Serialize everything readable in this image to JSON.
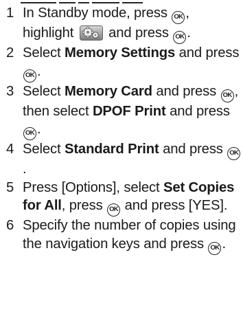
{
  "ok_glyph": "OK",
  "icons": {
    "settings": "settings-gear-icon"
  },
  "steps": [
    {
      "num": "1",
      "parts": [
        {
          "t": "text",
          "v": "In Standby mode, press "
        },
        {
          "t": "ok"
        },
        {
          "t": "text",
          "v": ", highlight "
        },
        {
          "t": "icon"
        },
        {
          "t": "text",
          "v": " and press "
        },
        {
          "t": "ok"
        },
        {
          "t": "text",
          "v": "."
        }
      ]
    },
    {
      "num": "2",
      "parts": [
        {
          "t": "text",
          "v": "Select "
        },
        {
          "t": "bold",
          "v": "Memory Settings"
        },
        {
          "t": "text",
          "v": " and press "
        },
        {
          "t": "ok"
        },
        {
          "t": "text",
          "v": "."
        }
      ]
    },
    {
      "num": "3",
      "parts": [
        {
          "t": "text",
          "v": "Select "
        },
        {
          "t": "bold",
          "v": "Memory Card"
        },
        {
          "t": "text",
          "v": " and press "
        },
        {
          "t": "ok"
        },
        {
          "t": "text",
          "v": ", then select "
        },
        {
          "t": "bold",
          "v": "DPOF Print"
        },
        {
          "t": "text",
          "v": " and press "
        },
        {
          "t": "ok"
        },
        {
          "t": "text",
          "v": "."
        }
      ]
    },
    {
      "num": "4",
      "parts": [
        {
          "t": "text",
          "v": "Select "
        },
        {
          "t": "bold",
          "v": "Standard Print"
        },
        {
          "t": "text",
          "v": " and press "
        },
        {
          "t": "ok"
        },
        {
          "t": "text",
          "v": "."
        }
      ]
    },
    {
      "num": "5",
      "parts": [
        {
          "t": "text",
          "v": "Press [Options], select "
        },
        {
          "t": "bold",
          "v": "Set Copies for All"
        },
        {
          "t": "text",
          "v": ", press "
        },
        {
          "t": "ok"
        },
        {
          "t": "text",
          "v": " and press [YES]."
        }
      ]
    },
    {
      "num": "6",
      "parts": [
        {
          "t": "text",
          "v": "Specify the number of copies using the navigation keys and press "
        },
        {
          "t": "ok"
        },
        {
          "t": "text",
          "v": "."
        }
      ]
    }
  ]
}
